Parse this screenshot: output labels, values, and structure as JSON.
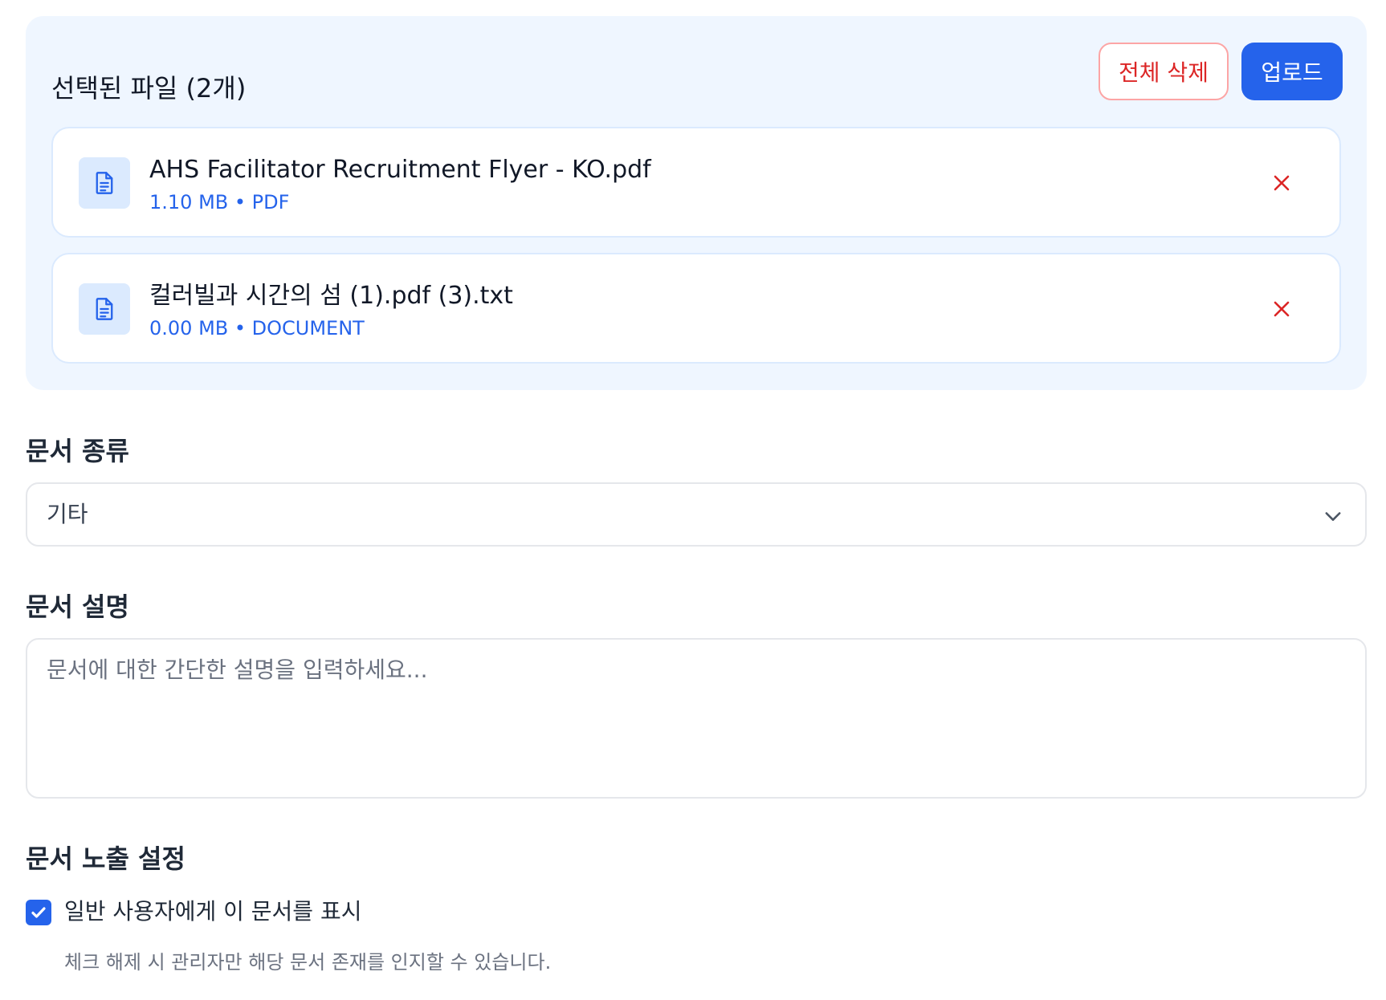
{
  "files_panel": {
    "title": "선택된 파일 (2개)",
    "clear_all_label": "전체 삭제",
    "upload_label": "업로드",
    "files": [
      {
        "name": "AHS Facilitator Recruitment Flyer - KO.pdf",
        "meta": "1.10 MB • PDF",
        "icon": "document-icon",
        "remove_icon": "close-icon"
      },
      {
        "name": "컬러빌과 시간의 섬 (1).pdf (3).txt",
        "meta": "0.00 MB • DOCUMENT",
        "icon": "document-icon",
        "remove_icon": "close-icon"
      }
    ]
  },
  "document_type": {
    "label": "문서 종류",
    "selected": "기타",
    "icon": "chevron-down-icon"
  },
  "document_description": {
    "label": "문서 설명",
    "placeholder": "문서에 대한 간단한 설명을 입력하세요...",
    "value": ""
  },
  "visibility": {
    "label": "문서 노출 설정",
    "checkbox_label": "일반 사용자에게 이 문서를 표시",
    "checked": true,
    "help_text": "체크 해제 시 관리자만 해당 문서 존재를 인지할 수 있습니다."
  },
  "colors": {
    "accent": "#2563eb",
    "danger": "#dc2626",
    "panel_bg": "#eff6ff"
  }
}
